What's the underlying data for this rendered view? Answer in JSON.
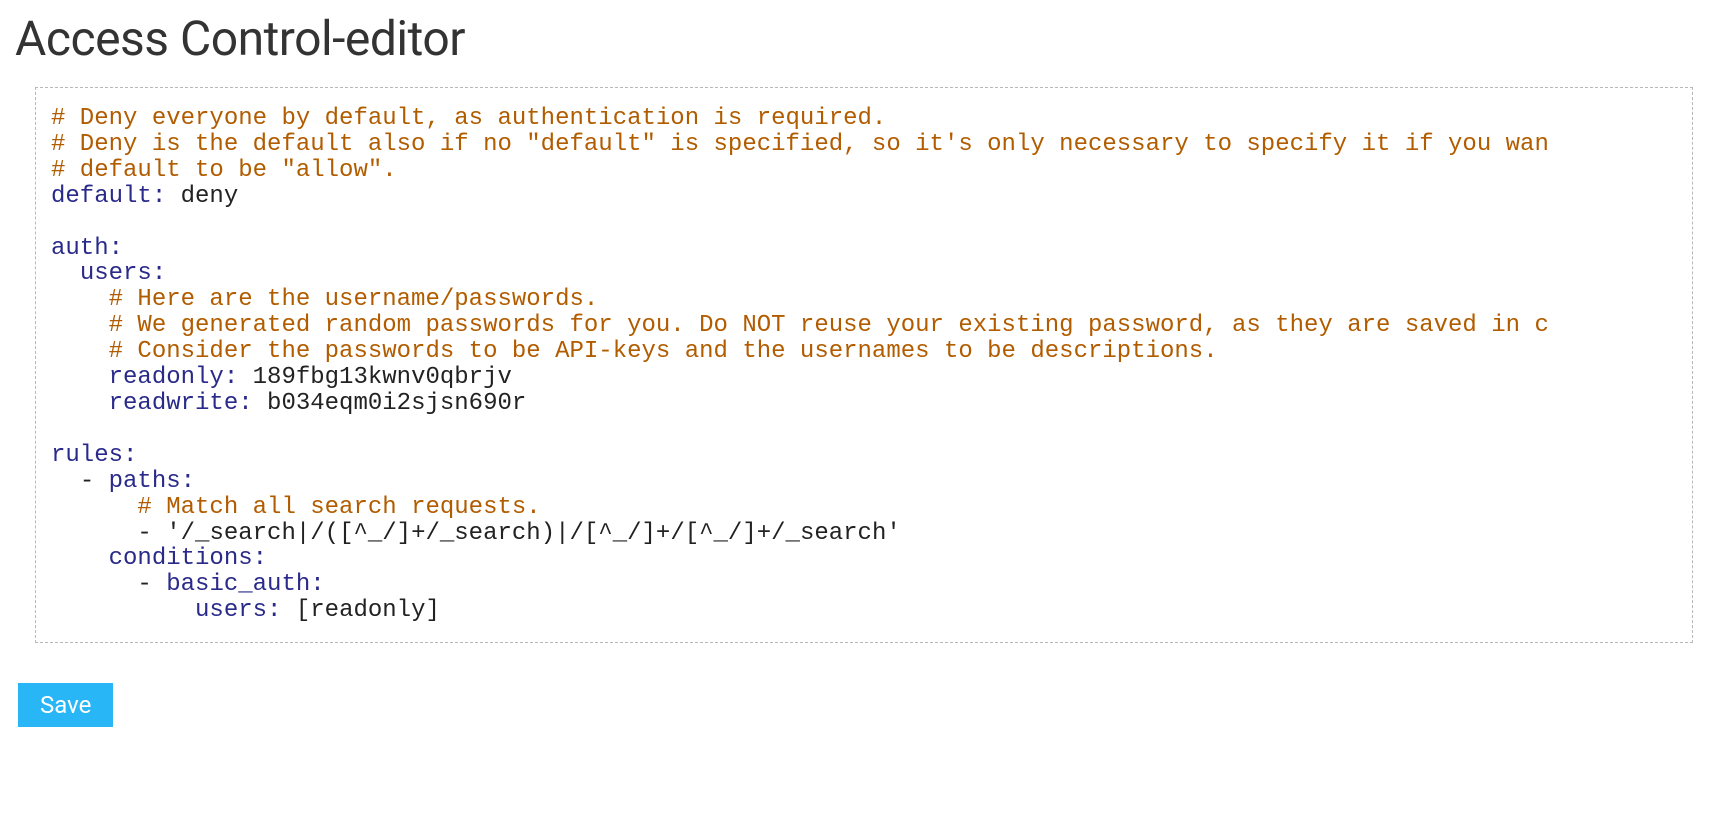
{
  "page": {
    "title": "Access Control-editor"
  },
  "editor": {
    "lines": [
      {
        "indent": 0,
        "segments": [
          {
            "cls": "c-comment",
            "text": "# Deny everyone by default, as authentication is required."
          }
        ]
      },
      {
        "indent": 0,
        "segments": [
          {
            "cls": "c-comment",
            "text": "# Deny is the default also if no \"default\" is specified, so it's only necessary to specify it if you wan"
          }
        ]
      },
      {
        "indent": 0,
        "segments": [
          {
            "cls": "c-comment",
            "text": "# default to be \"allow\"."
          }
        ]
      },
      {
        "indent": 0,
        "segments": [
          {
            "cls": "c-key",
            "text": "default:"
          },
          {
            "cls": "c-plain",
            "text": " deny"
          }
        ]
      },
      {
        "indent": 0,
        "segments": [
          {
            "cls": "c-plain",
            "text": " "
          }
        ]
      },
      {
        "indent": 0,
        "segments": [
          {
            "cls": "c-key",
            "text": "auth:"
          }
        ]
      },
      {
        "indent": 2,
        "segments": [
          {
            "cls": "c-key",
            "text": "users:"
          }
        ]
      },
      {
        "indent": 4,
        "segments": [
          {
            "cls": "c-comment",
            "text": "# Here are the username/passwords."
          }
        ]
      },
      {
        "indent": 4,
        "segments": [
          {
            "cls": "c-comment",
            "text": "# We generated random passwords for you. Do NOT reuse your existing password, as they are saved in c"
          }
        ]
      },
      {
        "indent": 4,
        "segments": [
          {
            "cls": "c-comment",
            "text": "# Consider the passwords to be API-keys and the usernames to be descriptions."
          }
        ]
      },
      {
        "indent": 4,
        "segments": [
          {
            "cls": "c-key",
            "text": "readonly:"
          },
          {
            "cls": "c-plain",
            "text": " 189fbg13kwnv0qbrjv"
          }
        ]
      },
      {
        "indent": 4,
        "segments": [
          {
            "cls": "c-key",
            "text": "readwrite:"
          },
          {
            "cls": "c-plain",
            "text": " b034eqm0i2sjsn690r"
          }
        ]
      },
      {
        "indent": 0,
        "segments": [
          {
            "cls": "c-plain",
            "text": " "
          }
        ]
      },
      {
        "indent": 0,
        "segments": [
          {
            "cls": "c-key",
            "text": "rules:"
          }
        ]
      },
      {
        "indent": 2,
        "segments": [
          {
            "cls": "c-plain",
            "text": "- "
          },
          {
            "cls": "c-key",
            "text": "paths:"
          }
        ]
      },
      {
        "indent": 6,
        "segments": [
          {
            "cls": "c-comment",
            "text": "# Match all search requests."
          }
        ]
      },
      {
        "indent": 6,
        "segments": [
          {
            "cls": "c-plain",
            "text": "- "
          },
          {
            "cls": "c-string",
            "text": "'/_search|/([^_/]+/_search)|/[^_/]+/[^_/]+/_search'"
          }
        ]
      },
      {
        "indent": 4,
        "segments": [
          {
            "cls": "c-key",
            "text": "conditions:"
          }
        ]
      },
      {
        "indent": 6,
        "segments": [
          {
            "cls": "c-plain",
            "text": "- "
          },
          {
            "cls": "c-key",
            "text": "basic_auth:"
          }
        ]
      },
      {
        "indent": 10,
        "segments": [
          {
            "cls": "c-key",
            "text": "users:"
          },
          {
            "cls": "c-plain",
            "text": " "
          },
          {
            "cls": "c-bracket",
            "text": "[readonly]"
          }
        ]
      }
    ]
  },
  "buttons": {
    "save_label": "Save"
  }
}
